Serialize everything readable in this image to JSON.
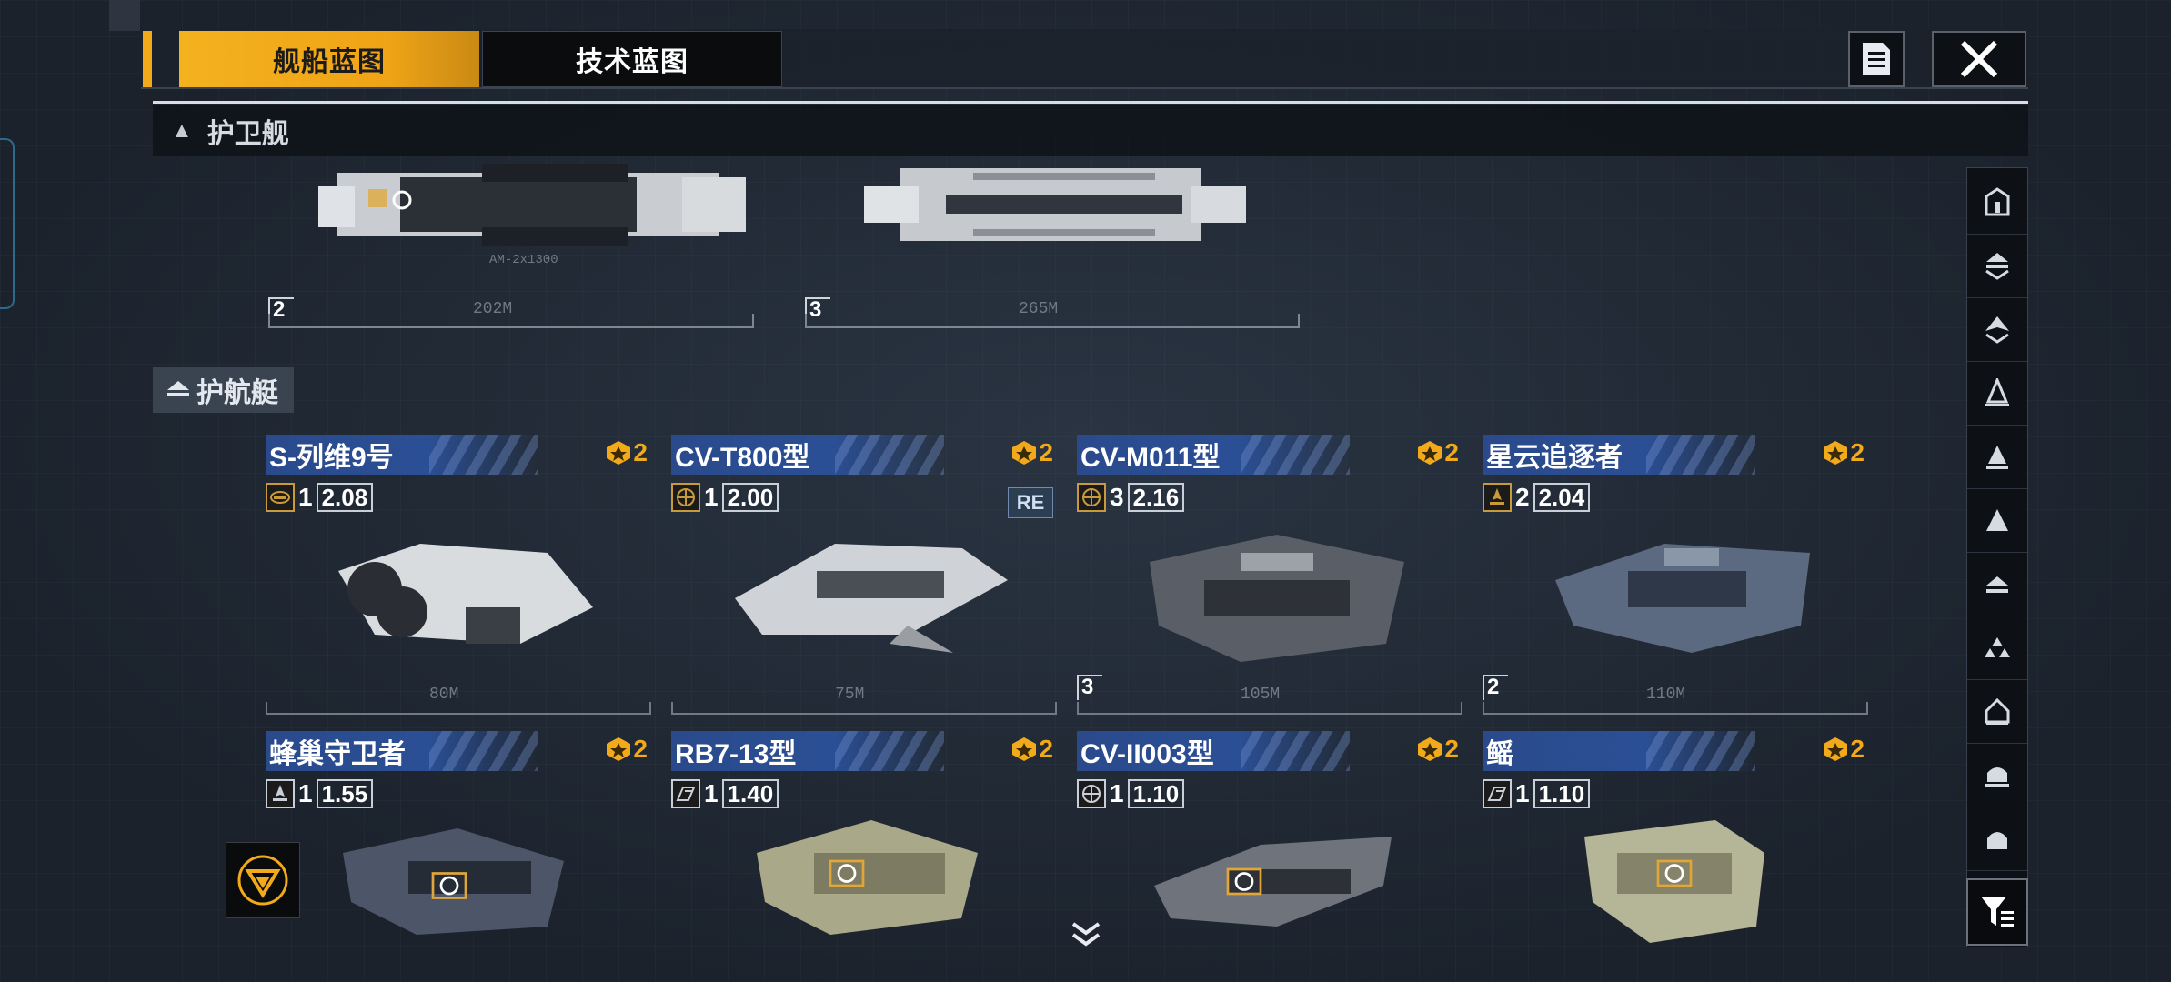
{
  "tabs": {
    "ship_blueprint": "舰船蓝图",
    "tech_blueprint": "技术蓝图"
  },
  "icons": {
    "document": "document-icon",
    "close": "close-icon",
    "filter": "filter-icon"
  },
  "sections": {
    "frigate": {
      "label": "护卫舰"
    },
    "corvette": {
      "label": "护航艇"
    }
  },
  "frigates": [
    {
      "count": "2",
      "length": "202M",
      "weapon_label": "AM-2x1300"
    },
    {
      "count": "3",
      "length": "265M"
    }
  ],
  "ships": [
    {
      "name": "S-列维9号",
      "rank": "2",
      "stat_icon": "torpedo-icon",
      "qty": "1",
      "value": "2.08",
      "length": "80M"
    },
    {
      "name": "CV-T800型",
      "rank": "2",
      "stat_icon": "globe-icon",
      "qty": "1",
      "value": "2.00",
      "badge": "RE",
      "length": "75M"
    },
    {
      "name": "CV-M011型",
      "rank": "2",
      "stat_icon": "globe-icon",
      "qty": "3",
      "value": "2.16",
      "length": "105M",
      "count": "3"
    },
    {
      "name": "星云追逐者",
      "rank": "2",
      "stat_icon": "rocket-icon",
      "qty": "2",
      "value": "2.04",
      "length": "110M",
      "count": "2"
    },
    {
      "name": "蜂巢守卫者",
      "rank": "2",
      "stat_icon": "rocket-icon",
      "qty": "1",
      "value": "1.55"
    },
    {
      "name": "RB7-13型",
      "rank": "2",
      "stat_icon": "speed-icon",
      "qty": "1",
      "value": "1.40"
    },
    {
      "name": "CV-II003型",
      "rank": "2",
      "stat_icon": "globe-icon",
      "qty": "1",
      "value": "1.10"
    },
    {
      "name": "鳐",
      "rank": "2",
      "stat_icon": "speed-icon",
      "qty": "1",
      "value": "1.10"
    }
  ],
  "colors": {
    "accent": "#f2a91a",
    "title_blue": "#2b4f95",
    "bg": "#1f2733"
  }
}
